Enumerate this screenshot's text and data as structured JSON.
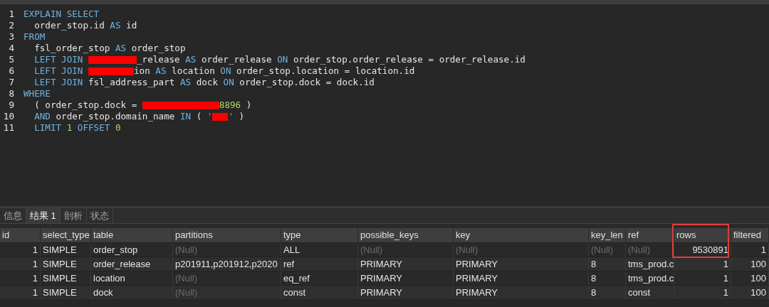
{
  "editor": {
    "lines": [
      {
        "number": "1",
        "tokens": [
          {
            "kind": "kw",
            "text": "EXPLAIN SELECT"
          }
        ]
      },
      {
        "number": "2",
        "tokens": [
          {
            "kind": "id",
            "text": "  order_stop.id "
          },
          {
            "kind": "kw",
            "text": "AS"
          },
          {
            "kind": "id",
            "text": " id"
          }
        ]
      },
      {
        "number": "3",
        "tokens": [
          {
            "kind": "kw",
            "text": "FROM"
          }
        ]
      },
      {
        "number": "4",
        "tokens": [
          {
            "kind": "id",
            "text": "  fsl_order_stop "
          },
          {
            "kind": "kw",
            "text": "AS"
          },
          {
            "kind": "id",
            "text": " order_stop"
          }
        ]
      },
      {
        "number": "5",
        "tokens": [
          {
            "kind": "kw",
            "text": "  LEFT JOIN "
          },
          {
            "kind": "redacted"
          },
          {
            "kind": "id",
            "text": "_release "
          },
          {
            "kind": "kw",
            "text": "AS"
          },
          {
            "kind": "id",
            "text": " order_release "
          },
          {
            "kind": "kw",
            "text": "ON"
          },
          {
            "kind": "id",
            "text": " order_stop.order_release = order_release.id"
          }
        ]
      },
      {
        "number": "6",
        "tokens": [
          {
            "kind": "kw",
            "text": "  LEFT JOIN "
          },
          {
            "kind": "redacted"
          },
          {
            "kind": "id",
            "text": "ion "
          },
          {
            "kind": "kw",
            "text": "AS"
          },
          {
            "kind": "id",
            "text": " location "
          },
          {
            "kind": "kw",
            "text": "ON"
          },
          {
            "kind": "id",
            "text": " order_stop.location = location.id"
          }
        ]
      },
      {
        "number": "7",
        "tokens": [
          {
            "kind": "kw",
            "text": "  LEFT JOIN "
          },
          {
            "kind": "id",
            "text": "fsl_address_part "
          },
          {
            "kind": "kw",
            "text": "AS"
          },
          {
            "kind": "id",
            "text": " dock "
          },
          {
            "kind": "kw",
            "text": "ON"
          },
          {
            "kind": "id",
            "text": " order_stop.dock = dock.id"
          }
        ]
      },
      {
        "number": "8",
        "tokens": [
          {
            "kind": "kw",
            "text": "WHERE"
          }
        ]
      },
      {
        "number": "9",
        "tokens": [
          {
            "kind": "id",
            "text": "  ( order_stop.dock = "
          },
          {
            "kind": "redacted"
          },
          {
            "kind": "num",
            "text": "8896"
          },
          {
            "kind": "id",
            "text": " )"
          }
        ]
      },
      {
        "number": "10",
        "tokens": [
          {
            "kind": "kw",
            "text": "  AND"
          },
          {
            "kind": "id",
            "text": " order_stop.domain_name "
          },
          {
            "kind": "kw",
            "text": "IN"
          },
          {
            "kind": "id",
            "text": " ( "
          },
          {
            "kind": "str",
            "text": "'"
          },
          {
            "kind": "redacted"
          },
          {
            "kind": "str",
            "text": "'"
          },
          {
            "kind": "id",
            "text": " )"
          }
        ]
      },
      {
        "number": "11",
        "tokens": [
          {
            "kind": "kw",
            "text": "  LIMIT "
          },
          {
            "kind": "num",
            "text": "1"
          },
          {
            "kind": "kw",
            "text": " OFFSET "
          },
          {
            "kind": "num",
            "text": "0"
          }
        ]
      }
    ]
  },
  "result_tabs": [
    {
      "label": "信息",
      "selected": false
    },
    {
      "label": "结果 1",
      "selected": true
    },
    {
      "label": "剖析",
      "selected": false
    },
    {
      "label": "状态",
      "selected": false
    }
  ],
  "table": {
    "columns": [
      {
        "label": "id"
      },
      {
        "label": "select_type"
      },
      {
        "label": "table"
      },
      {
        "label": "partitions"
      },
      {
        "label": "type"
      },
      {
        "label": "possible_keys"
      },
      {
        "label": "key"
      },
      {
        "label": "key_len"
      },
      {
        "label": "ref"
      },
      {
        "label": "rows",
        "highlighted": true
      },
      {
        "label": "filtered"
      }
    ],
    "rows": [
      [
        {
          "text": "1",
          "null": false
        },
        {
          "text": "SIMPLE",
          "null": false
        },
        {
          "text": "order_stop",
          "null": false
        },
        {
          "text": "(Null)",
          "null": true
        },
        {
          "text": "ALL",
          "null": false
        },
        {
          "text": "(Null)",
          "null": true
        },
        {
          "text": "(Null)",
          "null": true
        },
        {
          "text": "(Null)",
          "null": true
        },
        {
          "text": "(Null)",
          "null": true
        },
        {
          "text": "9530891",
          "null": false
        },
        {
          "text": "1",
          "null": false
        }
      ],
      [
        {
          "text": "1",
          "null": false
        },
        {
          "text": "SIMPLE",
          "null": false
        },
        {
          "text": "order_release",
          "null": false
        },
        {
          "text": "p201911,p201912,p2020",
          "null": false
        },
        {
          "text": "ref",
          "null": false
        },
        {
          "text": "PRIMARY",
          "null": false
        },
        {
          "text": "PRIMARY",
          "null": false
        },
        {
          "text": "8",
          "null": false
        },
        {
          "text": "tms_prod.c",
          "null": false
        },
        {
          "text": "1",
          "null": false
        },
        {
          "text": "100",
          "null": false
        }
      ],
      [
        {
          "text": "1",
          "null": false
        },
        {
          "text": "SIMPLE",
          "null": false
        },
        {
          "text": "location",
          "null": false
        },
        {
          "text": "(Null)",
          "null": true
        },
        {
          "text": "eq_ref",
          "null": false
        },
        {
          "text": "PRIMARY",
          "null": false
        },
        {
          "text": "PRIMARY",
          "null": false
        },
        {
          "text": "8",
          "null": false
        },
        {
          "text": "tms_prod.c",
          "null": false
        },
        {
          "text": "1",
          "null": false
        },
        {
          "text": "100",
          "null": false
        }
      ],
      [
        {
          "text": "1",
          "null": false
        },
        {
          "text": "SIMPLE",
          "null": false
        },
        {
          "text": "dock",
          "null": false
        },
        {
          "text": "(Null)",
          "null": true
        },
        {
          "text": "const",
          "null": false
        },
        {
          "text": "PRIMARY",
          "null": false
        },
        {
          "text": "PRIMARY",
          "null": false
        },
        {
          "text": "8",
          "null": false
        },
        {
          "text": "const",
          "null": false
        },
        {
          "text": "1",
          "null": false
        },
        {
          "text": "100",
          "null": false
        }
      ]
    ]
  }
}
